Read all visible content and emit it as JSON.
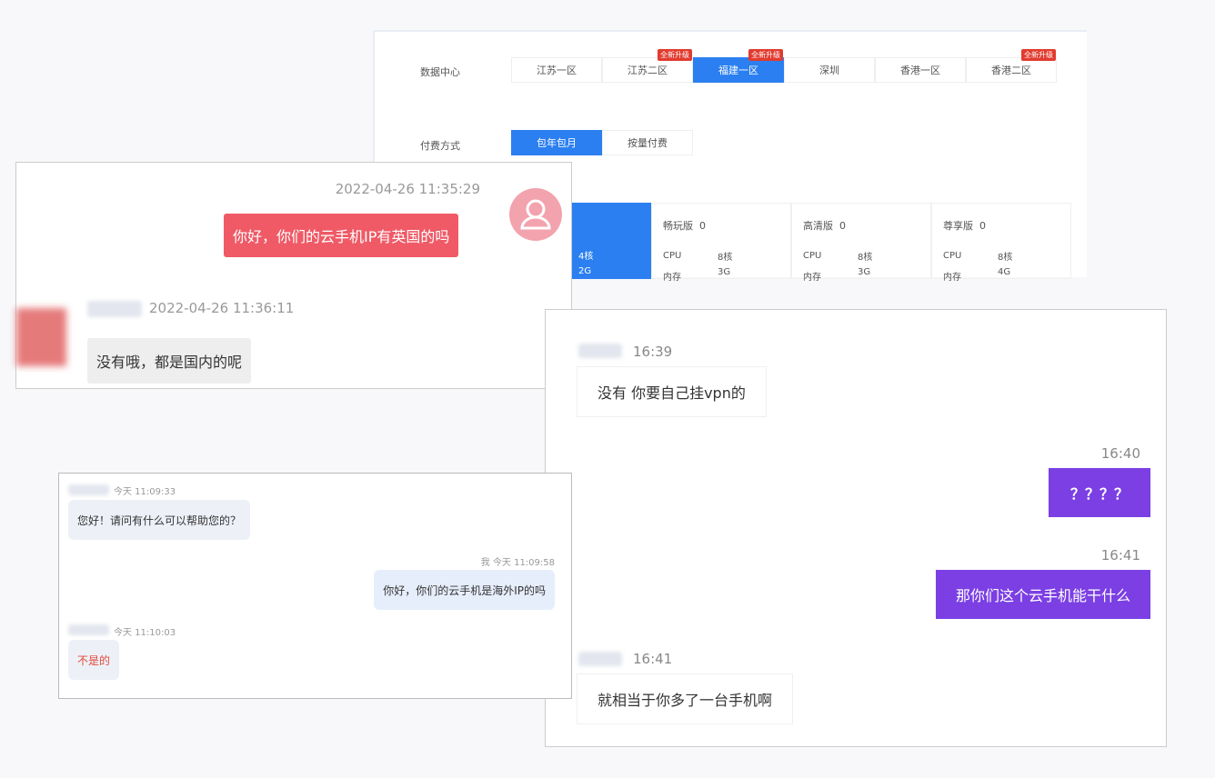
{
  "config_panel": {
    "datacenter_label": "数据中心",
    "regions": [
      {
        "label": "江苏一区",
        "badge": ""
      },
      {
        "label": "江苏二区",
        "badge": "全新升级"
      },
      {
        "label": "福建一区",
        "badge": "全新升级",
        "selected": true
      },
      {
        "label": "深圳",
        "badge": ""
      },
      {
        "label": "香港一区",
        "badge": ""
      },
      {
        "label": "香港二区",
        "badge": "全新升级"
      }
    ],
    "billing_label": "付费方式",
    "billing_options": [
      {
        "label": "包年包月",
        "selected": true
      },
      {
        "label": "按量付费"
      }
    ],
    "selected_card": {
      "cpu": "4核",
      "mem": "2G"
    },
    "cards": [
      {
        "name": "畅玩版",
        "count": "0",
        "cpu_label": "CPU",
        "cpu": "8核",
        "mem_label": "内存",
        "mem": "3G"
      },
      {
        "name": "高清版",
        "count": "0",
        "cpu_label": "CPU",
        "cpu": "8核",
        "mem_label": "内存",
        "mem": "3G"
      },
      {
        "name": "尊享版",
        "count": "0",
        "cpu_label": "CPU",
        "cpu": "8核",
        "mem_label": "内存",
        "mem": "4G"
      }
    ],
    "accent": "#2b7ff0"
  },
  "chat1": {
    "msg1_time": "2022-04-26 11:35:29",
    "msg1_text": "你好，你们的云手机IP有英国的吗",
    "msg2_time": "2022-04-26 11:36:11",
    "msg2_text": "没有哦，都是国内的呢",
    "bubble_color": "#ef5a66"
  },
  "chat2": {
    "m1_time": "16:39",
    "m1_text": "没有 你要自己挂vpn的",
    "m2_time": "16:40",
    "m2_text": "？？？？",
    "m3_time": "16:41",
    "m3_text": "那你们这个云手机能干什么",
    "m4_time": "16:41",
    "m4_text": "就相当于你多了一台手机啊",
    "bubble_color": "#7b3fe4"
  },
  "chat3": {
    "m1_time": "今天 11:09:33",
    "m1_text": "您好！请问有什么可以帮助您的？",
    "m2_time": "我 今天 11:09:58",
    "m2_text": "你好，你们的云手机是海外IP的吗",
    "m3_time": "今天 11:10:03",
    "m3_text": "不是的"
  }
}
